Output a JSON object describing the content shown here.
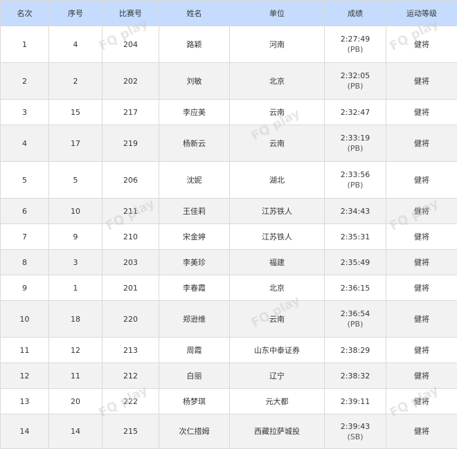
{
  "columns": [
    "名次",
    "序号",
    "比赛号",
    "姓名",
    "单位",
    "成绩",
    "运动等级"
  ],
  "rows": [
    {
      "rank": "1",
      "seq": "4",
      "bib": "204",
      "name": "路颖",
      "unit": "河南",
      "time": "2:27:49",
      "note": "(PB)",
      "level": "健将"
    },
    {
      "rank": "2",
      "seq": "2",
      "bib": "202",
      "name": "刘敏",
      "unit": "北京",
      "time": "2:32:05",
      "note": "(PB)",
      "level": "健将"
    },
    {
      "rank": "3",
      "seq": "15",
      "bib": "217",
      "name": "李应美",
      "unit": "云南",
      "time": "2:32:47",
      "note": "",
      "level": "健将"
    },
    {
      "rank": "4",
      "seq": "17",
      "bib": "219",
      "name": "杨新云",
      "unit": "云南",
      "time": "2:33:19",
      "note": "(PB)",
      "level": "健将"
    },
    {
      "rank": "5",
      "seq": "5",
      "bib": "206",
      "name": "沈妮",
      "unit": "湖北",
      "time": "2:33:56",
      "note": "(PB)",
      "level": "健将"
    },
    {
      "rank": "6",
      "seq": "10",
      "bib": "211",
      "name": "王佳莉",
      "unit": "江苏铁人",
      "time": "2:34:43",
      "note": "",
      "level": "健将"
    },
    {
      "rank": "7",
      "seq": "9",
      "bib": "210",
      "name": "宋金婷",
      "unit": "江苏铁人",
      "time": "2:35:31",
      "note": "",
      "level": "健将"
    },
    {
      "rank": "8",
      "seq": "3",
      "bib": "203",
      "name": "李美珍",
      "unit": "福建",
      "time": "2:35:49",
      "note": "",
      "level": "健将"
    },
    {
      "rank": "9",
      "seq": "1",
      "bib": "201",
      "name": "李春霞",
      "unit": "北京",
      "time": "2:36:15",
      "note": "",
      "level": "健将"
    },
    {
      "rank": "10",
      "seq": "18",
      "bib": "220",
      "name": "郑逊维",
      "unit": "云南",
      "time": "2:36:54",
      "note": "(PB)",
      "level": "健将"
    },
    {
      "rank": "11",
      "seq": "12",
      "bib": "213",
      "name": "周霞",
      "unit": "山东中泰证券",
      "time": "2:38:29",
      "note": "",
      "level": "健将"
    },
    {
      "rank": "12",
      "seq": "11",
      "bib": "212",
      "name": "白丽",
      "unit": "辽宁",
      "time": "2:38:32",
      "note": "",
      "level": "健将"
    },
    {
      "rank": "13",
      "seq": "20",
      "bib": "222",
      "name": "杨梦琪",
      "unit": "元大都",
      "time": "2:39:11",
      "note": "",
      "level": "健将"
    },
    {
      "rank": "14",
      "seq": "14",
      "bib": "215",
      "name": "次仁措姆",
      "unit": "西藏拉萨城投",
      "time": "2:39:43",
      "note": "(SB)",
      "level": "健将"
    }
  ],
  "watermark": "FQ play"
}
